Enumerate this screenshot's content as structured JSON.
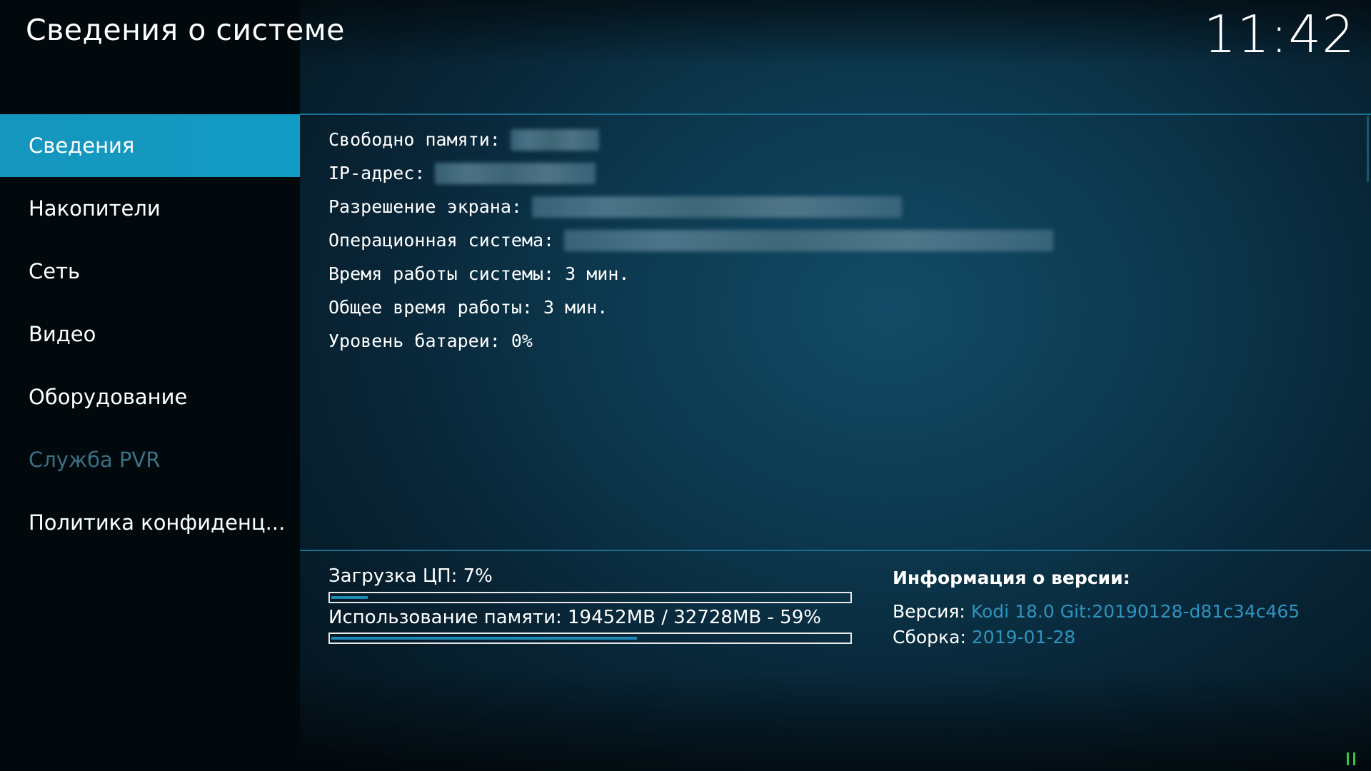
{
  "header": {
    "title": "Сведения о системе",
    "clock": "11:42"
  },
  "sidebar": {
    "items": [
      {
        "label": "Сведения",
        "state": "active"
      },
      {
        "label": "Накопители",
        "state": "normal"
      },
      {
        "label": "Сеть",
        "state": "normal"
      },
      {
        "label": "Видео",
        "state": "normal"
      },
      {
        "label": "Оборудование",
        "state": "normal"
      },
      {
        "label": "Служба PVR",
        "state": "disabled"
      },
      {
        "label": "Политика конфиденц...",
        "state": "normal"
      }
    ]
  },
  "info": {
    "free_memory_label": "Свободно памяти:",
    "ip_label": "IP-адрес:",
    "resolution_label": "Разрешение экрана:",
    "os_label": "Операционная система:",
    "uptime": "Время работы системы: 3 мин.",
    "total_uptime": "Общее время работы: 3 мин.",
    "battery": "Уровень батареи: 0%"
  },
  "stats": {
    "cpu_label": "Загрузка ЦП: 7%",
    "cpu_fraction": 0.07,
    "memory_label": "Использование памяти: 19452MB / 32728MB - 59%",
    "memory_fraction": 0.59
  },
  "version": {
    "title": "Информация о версии:",
    "version_label": "Версия:",
    "version_value": "Kodi 18.0 Git:20190128-d81c34c465",
    "build_label": "Сборка:",
    "build_value": "2019-01-28"
  },
  "colors": {
    "accent": "#129bc4",
    "progress_fill": "#1d8bb8",
    "version_value": "#2f93bd",
    "disabled_text": "#3c6f85",
    "pause_icon": "#35c43c"
  },
  "icons": {
    "player_status": "pause-icon"
  }
}
